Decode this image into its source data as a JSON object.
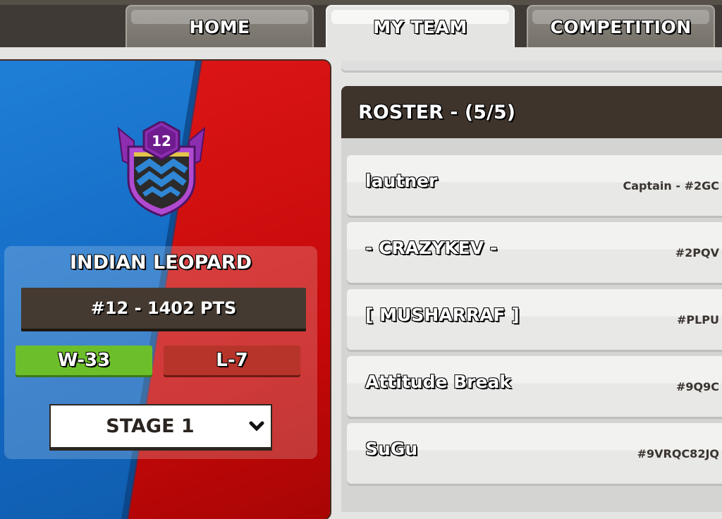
{
  "tabs": [
    {
      "label": "HOME",
      "active": false
    },
    {
      "label": "MY TEAM",
      "active": true
    },
    {
      "label": "COMPETITION",
      "active": false
    }
  ],
  "team": {
    "level": "12",
    "name": "INDIAN LEOPARD",
    "rank_points": "#12 - 1402 PTS",
    "wins": "W-33",
    "losses": "L-7",
    "stage": "STAGE 1"
  },
  "roster": {
    "title": "ROSTER - (5/5)",
    "players": [
      {
        "name": "lautner",
        "tag": "Captain - #2GC"
      },
      {
        "name": "- CRAZYKEV -",
        "tag": "#2PQV"
      },
      {
        "name": "[ MUSHARRAF ]",
        "tag": "#PLPU"
      },
      {
        "name": "Attitude Break",
        "tag": "#9Q9C"
      },
      {
        "name": "SuGu",
        "tag": "#9VRQC82JQ"
      }
    ]
  },
  "colors": {
    "blue_side": "#1266c0",
    "red_side": "#c40808",
    "win": "#6cbf2a",
    "loss": "#b7342b",
    "header_dark": "#3f342c",
    "badge_purple": "#a93cc6"
  },
  "icons": {
    "badge": "clan-badge-icon",
    "dropdown": "chevron-down-icon"
  }
}
